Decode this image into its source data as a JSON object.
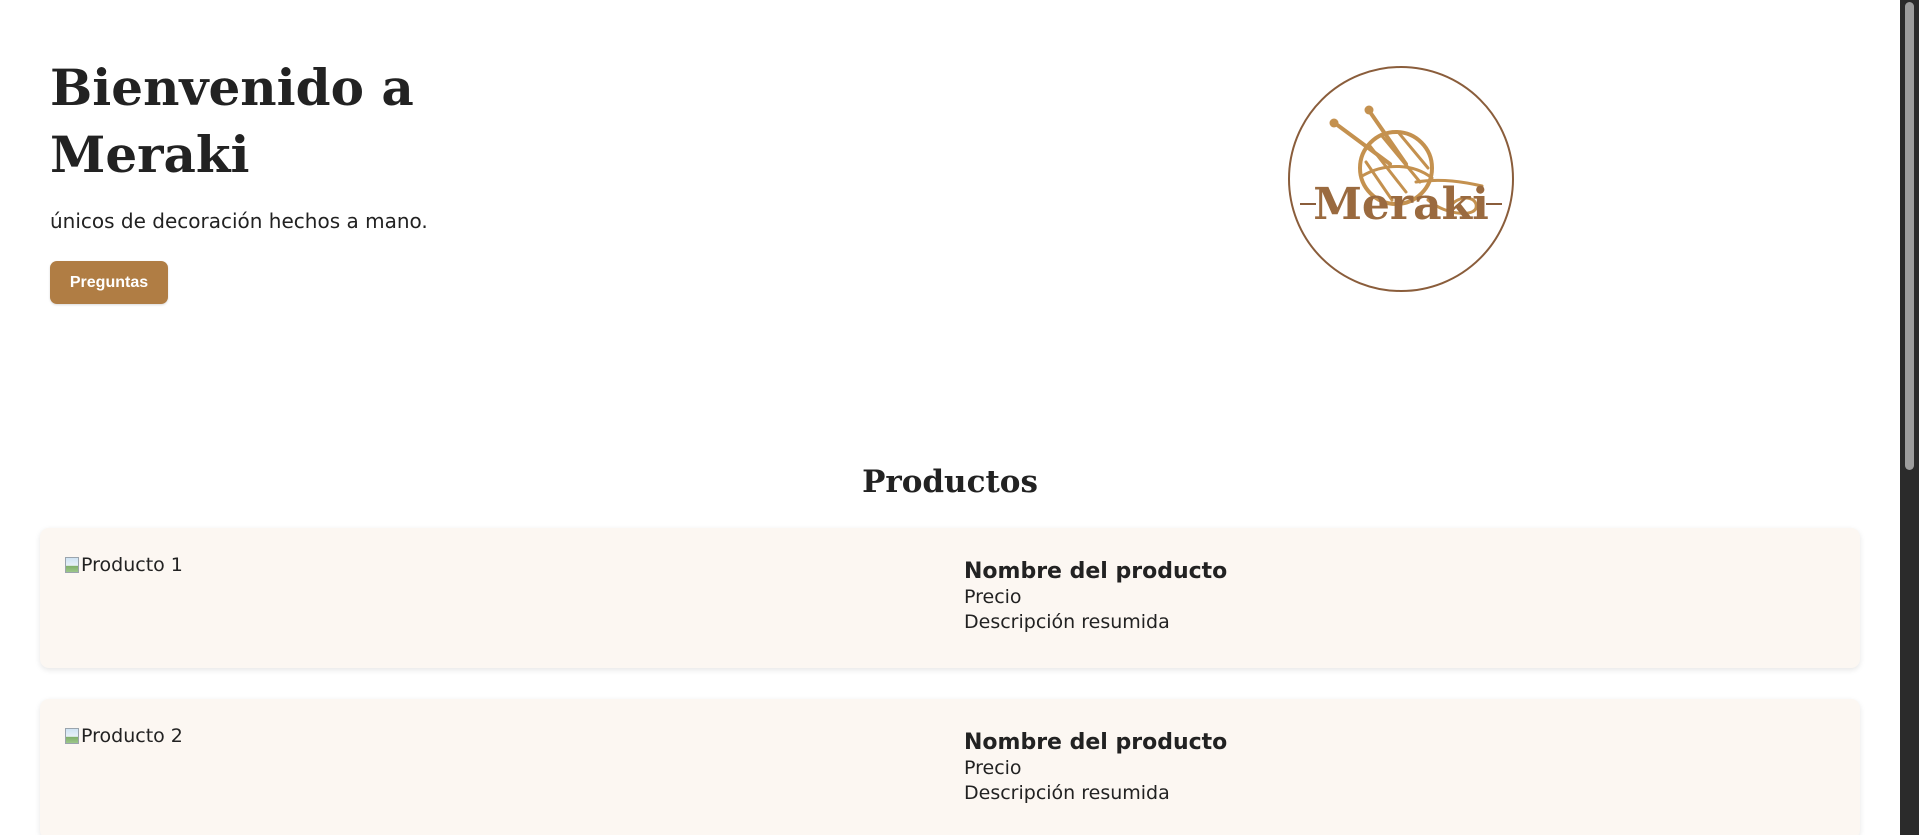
{
  "hero": {
    "title": "Bienvenido a Meraki",
    "subtitle": "únicos de decoración hechos a mano.",
    "button_label": "Preguntas"
  },
  "logo": {
    "text": "Meraki",
    "icon": "yarn-ball-knitting-needles-icon",
    "color": "#b07d44",
    "ring_color": "#8a5d3b"
  },
  "products": {
    "section_title": "Productos",
    "items": [
      {
        "image_alt": "Producto 1",
        "name": "Nombre del producto",
        "price": "Precio",
        "description": "Descripción resumida"
      },
      {
        "image_alt": "Producto 2",
        "name": "Nombre del producto",
        "price": "Precio",
        "description": "Descripción resumida"
      }
    ]
  },
  "colors": {
    "accent": "#b07d44",
    "card_background": "#fcf7f2",
    "text": "#222222"
  }
}
